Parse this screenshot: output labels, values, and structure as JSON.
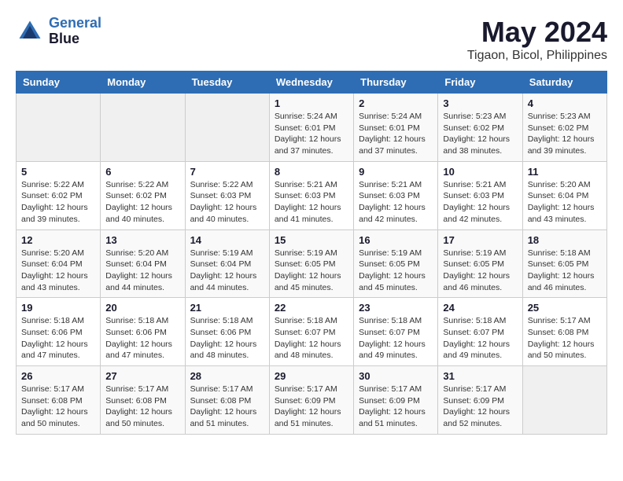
{
  "header": {
    "logo_line1": "General",
    "logo_line2": "Blue",
    "main_title": "May 2024",
    "subtitle": "Tigaon, Bicol, Philippines"
  },
  "calendar": {
    "days_of_week": [
      "Sunday",
      "Monday",
      "Tuesday",
      "Wednesday",
      "Thursday",
      "Friday",
      "Saturday"
    ],
    "weeks": [
      [
        {
          "day": "",
          "info": ""
        },
        {
          "day": "",
          "info": ""
        },
        {
          "day": "",
          "info": ""
        },
        {
          "day": "1",
          "info": "Sunrise: 5:24 AM\nSunset: 6:01 PM\nDaylight: 12 hours and 37 minutes."
        },
        {
          "day": "2",
          "info": "Sunrise: 5:24 AM\nSunset: 6:01 PM\nDaylight: 12 hours and 37 minutes."
        },
        {
          "day": "3",
          "info": "Sunrise: 5:23 AM\nSunset: 6:02 PM\nDaylight: 12 hours and 38 minutes."
        },
        {
          "day": "4",
          "info": "Sunrise: 5:23 AM\nSunset: 6:02 PM\nDaylight: 12 hours and 39 minutes."
        }
      ],
      [
        {
          "day": "5",
          "info": "Sunrise: 5:22 AM\nSunset: 6:02 PM\nDaylight: 12 hours and 39 minutes."
        },
        {
          "day": "6",
          "info": "Sunrise: 5:22 AM\nSunset: 6:02 PM\nDaylight: 12 hours and 40 minutes."
        },
        {
          "day": "7",
          "info": "Sunrise: 5:22 AM\nSunset: 6:03 PM\nDaylight: 12 hours and 40 minutes."
        },
        {
          "day": "8",
          "info": "Sunrise: 5:21 AM\nSunset: 6:03 PM\nDaylight: 12 hours and 41 minutes."
        },
        {
          "day": "9",
          "info": "Sunrise: 5:21 AM\nSunset: 6:03 PM\nDaylight: 12 hours and 42 minutes."
        },
        {
          "day": "10",
          "info": "Sunrise: 5:21 AM\nSunset: 6:03 PM\nDaylight: 12 hours and 42 minutes."
        },
        {
          "day": "11",
          "info": "Sunrise: 5:20 AM\nSunset: 6:04 PM\nDaylight: 12 hours and 43 minutes."
        }
      ],
      [
        {
          "day": "12",
          "info": "Sunrise: 5:20 AM\nSunset: 6:04 PM\nDaylight: 12 hours and 43 minutes."
        },
        {
          "day": "13",
          "info": "Sunrise: 5:20 AM\nSunset: 6:04 PM\nDaylight: 12 hours and 44 minutes."
        },
        {
          "day": "14",
          "info": "Sunrise: 5:19 AM\nSunset: 6:04 PM\nDaylight: 12 hours and 44 minutes."
        },
        {
          "day": "15",
          "info": "Sunrise: 5:19 AM\nSunset: 6:05 PM\nDaylight: 12 hours and 45 minutes."
        },
        {
          "day": "16",
          "info": "Sunrise: 5:19 AM\nSunset: 6:05 PM\nDaylight: 12 hours and 45 minutes."
        },
        {
          "day": "17",
          "info": "Sunrise: 5:19 AM\nSunset: 6:05 PM\nDaylight: 12 hours and 46 minutes."
        },
        {
          "day": "18",
          "info": "Sunrise: 5:18 AM\nSunset: 6:05 PM\nDaylight: 12 hours and 46 minutes."
        }
      ],
      [
        {
          "day": "19",
          "info": "Sunrise: 5:18 AM\nSunset: 6:06 PM\nDaylight: 12 hours and 47 minutes."
        },
        {
          "day": "20",
          "info": "Sunrise: 5:18 AM\nSunset: 6:06 PM\nDaylight: 12 hours and 47 minutes."
        },
        {
          "day": "21",
          "info": "Sunrise: 5:18 AM\nSunset: 6:06 PM\nDaylight: 12 hours and 48 minutes."
        },
        {
          "day": "22",
          "info": "Sunrise: 5:18 AM\nSunset: 6:07 PM\nDaylight: 12 hours and 48 minutes."
        },
        {
          "day": "23",
          "info": "Sunrise: 5:18 AM\nSunset: 6:07 PM\nDaylight: 12 hours and 49 minutes."
        },
        {
          "day": "24",
          "info": "Sunrise: 5:18 AM\nSunset: 6:07 PM\nDaylight: 12 hours and 49 minutes."
        },
        {
          "day": "25",
          "info": "Sunrise: 5:17 AM\nSunset: 6:08 PM\nDaylight: 12 hours and 50 minutes."
        }
      ],
      [
        {
          "day": "26",
          "info": "Sunrise: 5:17 AM\nSunset: 6:08 PM\nDaylight: 12 hours and 50 minutes."
        },
        {
          "day": "27",
          "info": "Sunrise: 5:17 AM\nSunset: 6:08 PM\nDaylight: 12 hours and 50 minutes."
        },
        {
          "day": "28",
          "info": "Sunrise: 5:17 AM\nSunset: 6:08 PM\nDaylight: 12 hours and 51 minutes."
        },
        {
          "day": "29",
          "info": "Sunrise: 5:17 AM\nSunset: 6:09 PM\nDaylight: 12 hours and 51 minutes."
        },
        {
          "day": "30",
          "info": "Sunrise: 5:17 AM\nSunset: 6:09 PM\nDaylight: 12 hours and 51 minutes."
        },
        {
          "day": "31",
          "info": "Sunrise: 5:17 AM\nSunset: 6:09 PM\nDaylight: 12 hours and 52 minutes."
        },
        {
          "day": "",
          "info": ""
        }
      ]
    ]
  }
}
